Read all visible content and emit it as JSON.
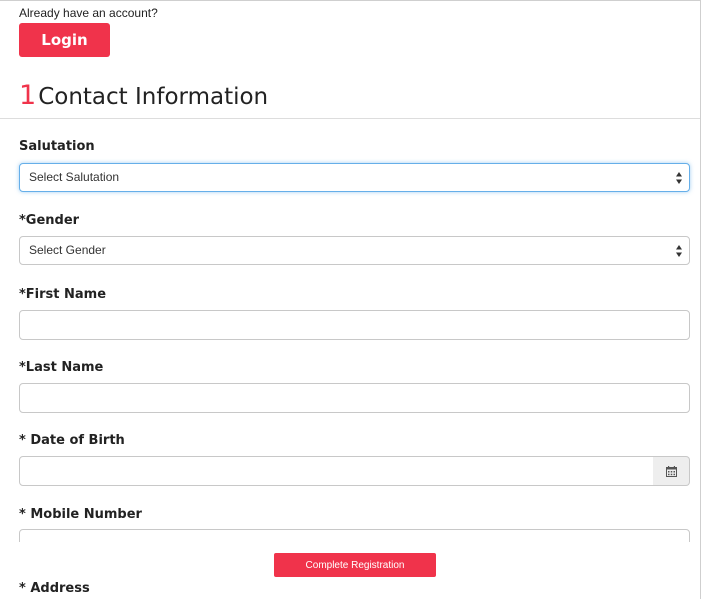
{
  "account": {
    "prompt": "Already have an account?",
    "login_label": "Login"
  },
  "section": {
    "number": "1",
    "title": "Contact Information"
  },
  "fields": {
    "salutation": {
      "label": "Salutation",
      "value": "Select Salutation"
    },
    "gender": {
      "label": "*Gender",
      "value": "Select Gender"
    },
    "first_name": {
      "label": "*First Name",
      "value": ""
    },
    "last_name": {
      "label": "*Last Name",
      "value": ""
    },
    "date_of_birth": {
      "label": "* Date of Birth",
      "value": "",
      "icon": "calendar-icon"
    },
    "mobile_number": {
      "label": "* Mobile Number",
      "value": ""
    },
    "address": {
      "label": "* Address"
    }
  },
  "footer": {
    "complete_label": "Complete Registration"
  },
  "colors": {
    "accent": "#f0334b",
    "focus": "#66afe9",
    "border": "#c8c8c8",
    "addon_bg": "#eeeeee"
  }
}
